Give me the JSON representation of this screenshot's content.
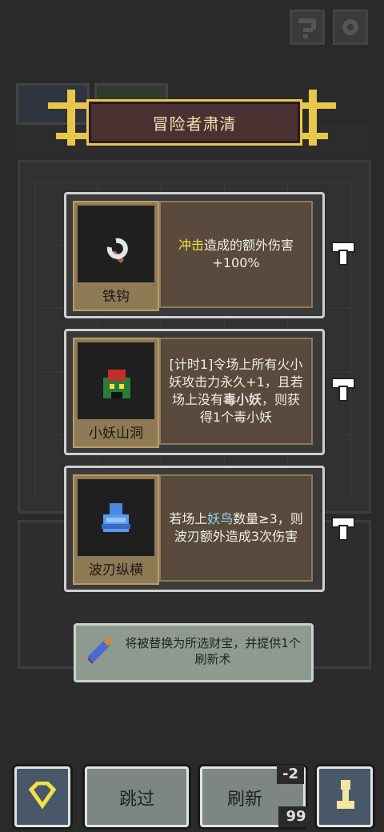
{
  "banner": {
    "title": "冒险者肃清"
  },
  "cards": [
    {
      "name": "铁钩",
      "desc_parts": [
        {
          "t": "冲击",
          "c": "hl-y"
        },
        {
          "t": "造成的额外伤害+100%",
          "c": ""
        }
      ]
    },
    {
      "name": "小妖山洞",
      "desc_parts": [
        {
          "t": "[计时1]令场上所有火小妖攻击力永久+1，且若场上没有",
          "c": ""
        },
        {
          "t": "毒小妖",
          "c": "hl-d"
        },
        {
          "t": "，则获得1个毒小妖",
          "c": ""
        }
      ]
    },
    {
      "name": "波刃纵横",
      "desc_parts": [
        {
          "t": "若场上",
          "c": ""
        },
        {
          "t": "妖鸟",
          "c": "hl-b"
        },
        {
          "t": "数量≥3，则波刃额外造成3次伤害",
          "c": ""
        }
      ]
    }
  ],
  "info": {
    "text": "将被替换为所选财宝，并提供1个刷新术"
  },
  "buttons": {
    "skip": "跳过",
    "refresh": "刷新",
    "refresh_cost": "-2",
    "refresh_count": "99"
  },
  "colors": {
    "gold": "#e8c64a",
    "banner_bg": "#4a3232",
    "card_desc_bg": "#594a3d",
    "info_bg": "#8e9a90"
  }
}
